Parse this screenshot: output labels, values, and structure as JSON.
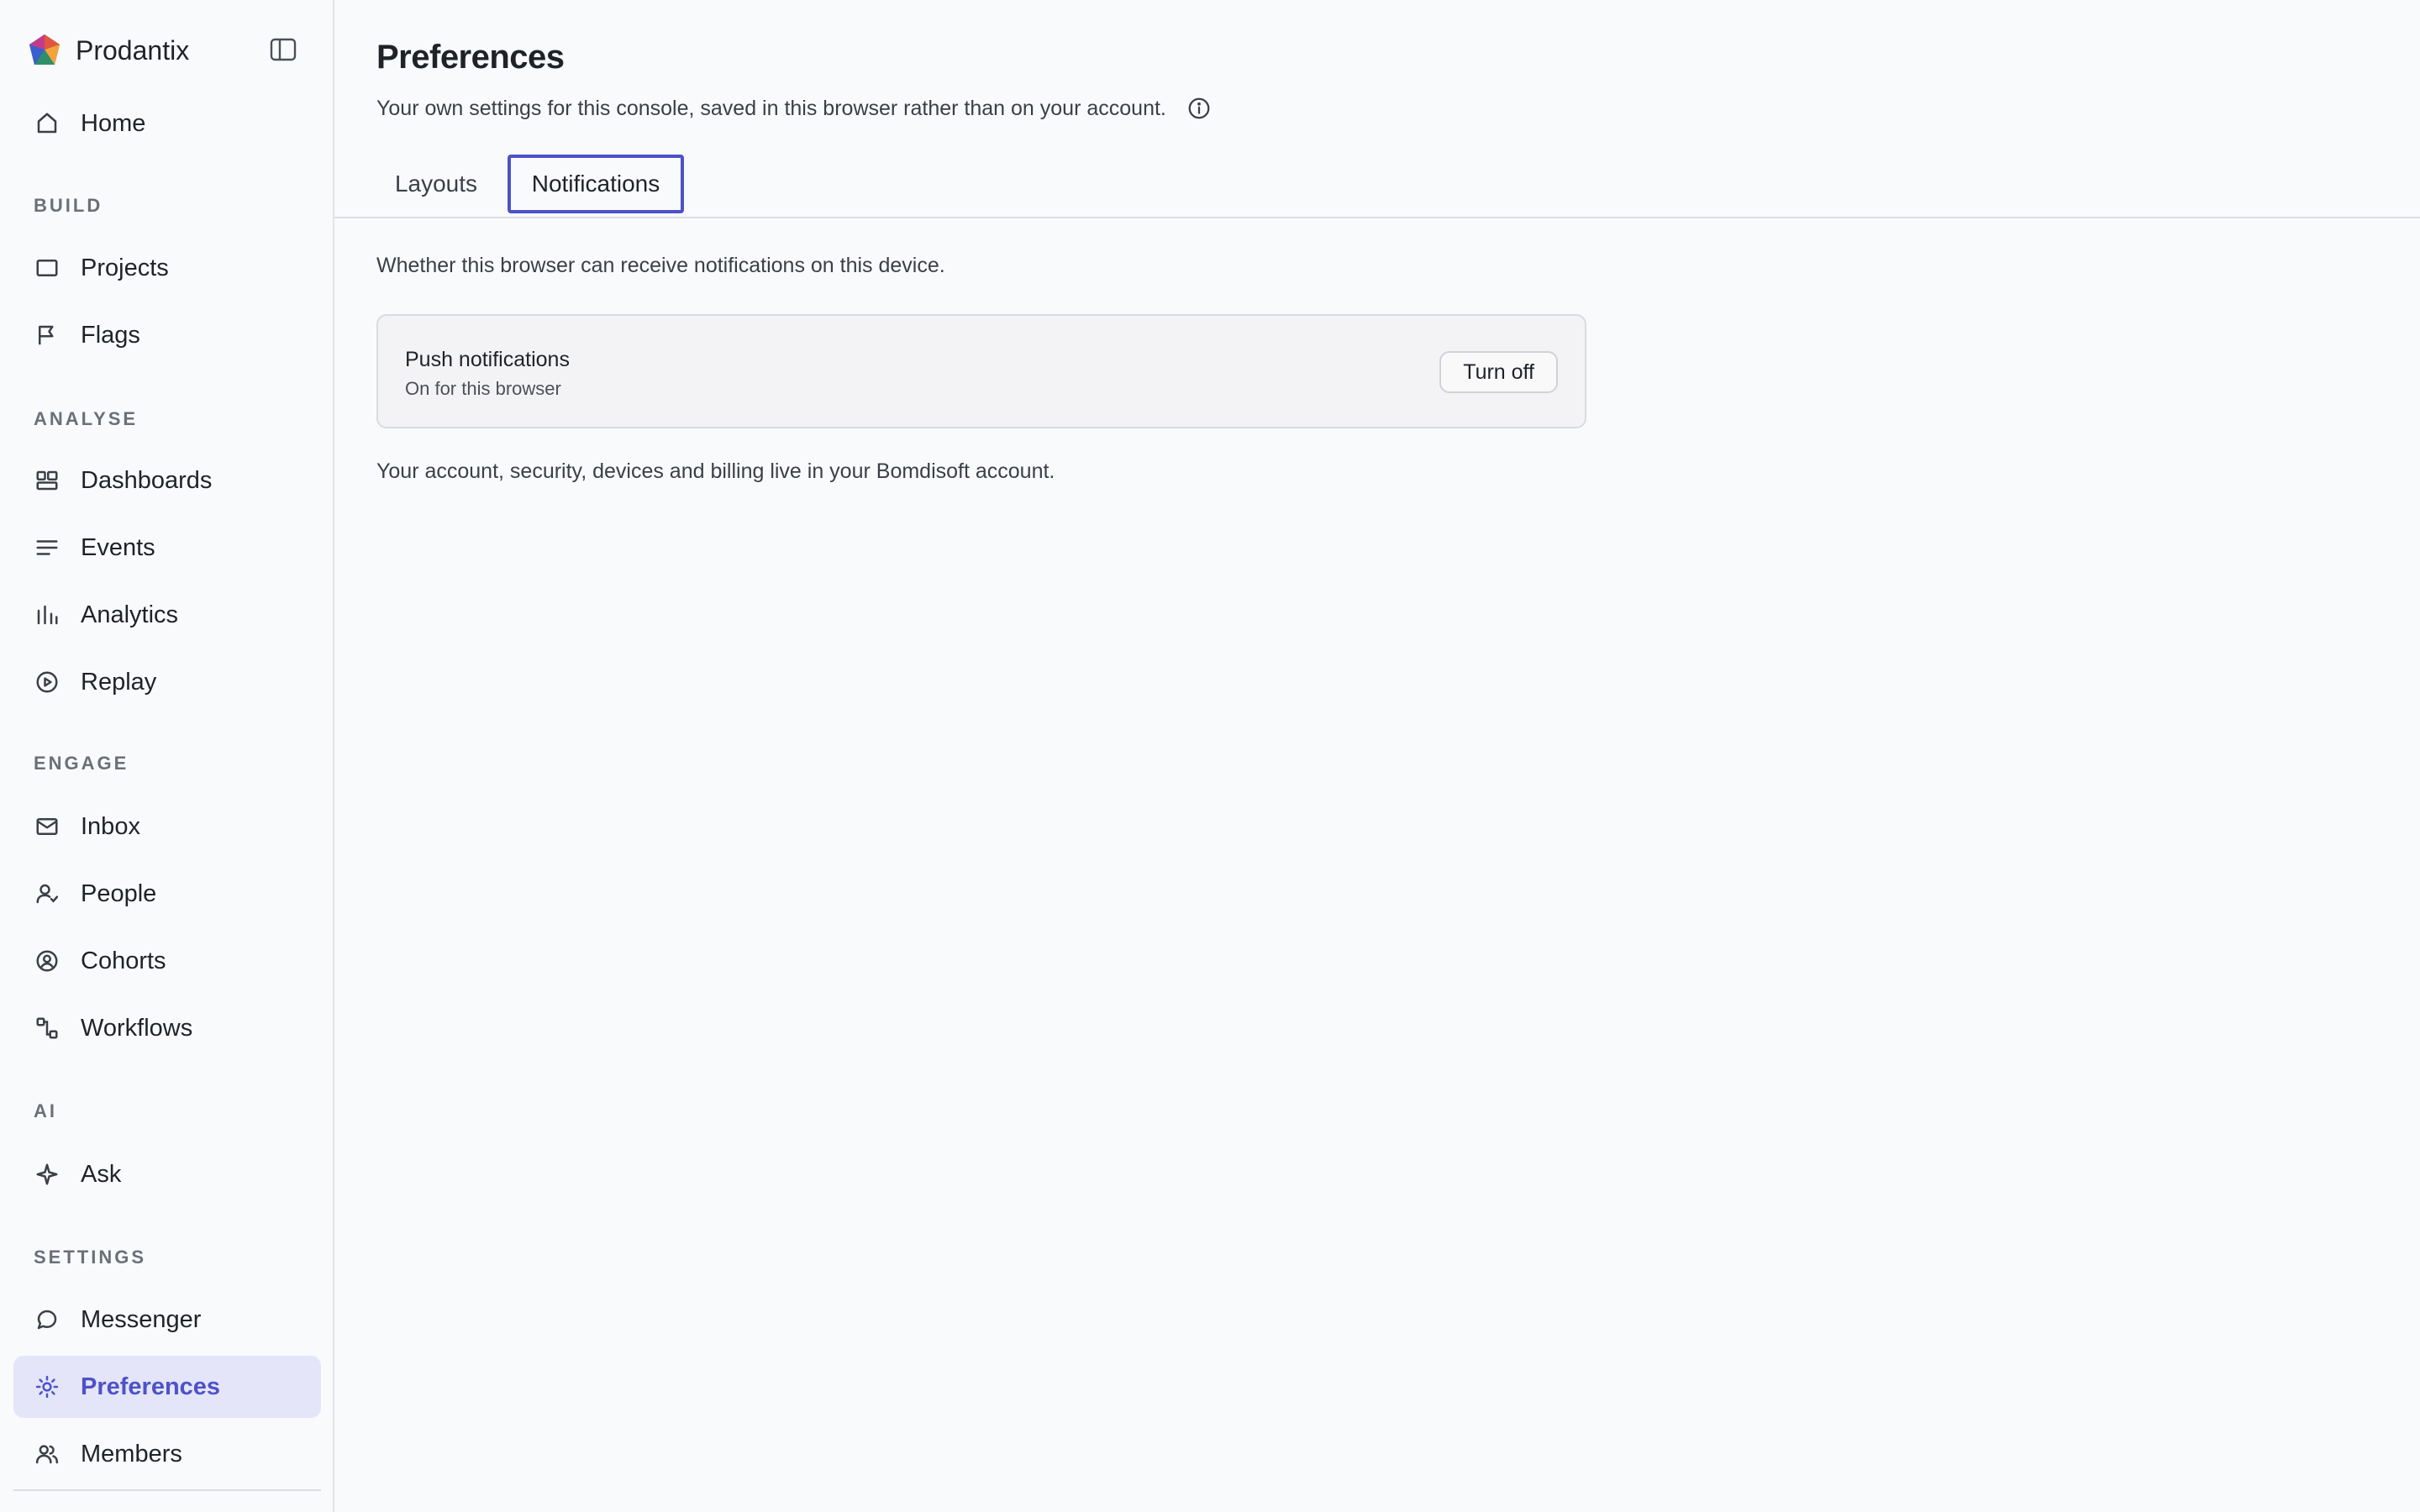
{
  "app": {
    "name": "Prodantix",
    "accent_color": "#4d52c8"
  },
  "sidebar": {
    "home": {
      "label": "Home",
      "icon": "home-icon"
    },
    "sections": {
      "build": "BUILD",
      "analyse": "ANALYSE",
      "engage": "ENGAGE",
      "ai": "AI",
      "settings": "SETTINGS"
    },
    "items": [
      {
        "label": "Projects",
        "icon": "square-icon"
      },
      {
        "label": "Flags",
        "icon": "flag-icon"
      },
      {
        "label": "Dashboards",
        "icon": "dashboard-icon"
      },
      {
        "label": "Events",
        "icon": "list-icon"
      },
      {
        "label": "Analytics",
        "icon": "bar-chart-icon"
      },
      {
        "label": "Replay",
        "icon": "play-circle-icon"
      },
      {
        "label": "Inbox",
        "icon": "mail-icon"
      },
      {
        "label": "People",
        "icon": "person-icon"
      },
      {
        "label": "Cohorts",
        "icon": "cohort-icon"
      },
      {
        "label": "Workflows",
        "icon": "workflow-icon"
      },
      {
        "label": "Ask",
        "icon": "sparkle-icon"
      },
      {
        "label": "Messenger",
        "icon": "chat-bubble-icon"
      },
      {
        "label": "Preferences",
        "icon": "sun-gear-icon",
        "active": true
      },
      {
        "label": "Members",
        "icon": "members-icon"
      }
    ]
  },
  "page": {
    "title": "Preferences",
    "subtitle": "Your own settings for this console, saved in this browser rather than on your account."
  },
  "tabs": [
    {
      "label": "Layouts",
      "selected": false
    },
    {
      "label": "Notifications",
      "selected": true
    }
  ],
  "notifications": {
    "description": "Whether this browser can receive notifications on this device.",
    "card": {
      "title": "Push notifications",
      "status": "On for this browser",
      "button_label": "Turn off"
    },
    "footer": "Your account, security, devices and billing live in your Bomdisoft account."
  }
}
